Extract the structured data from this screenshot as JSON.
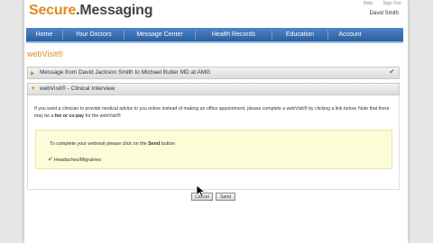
{
  "brand": {
    "part1": "Secure",
    "part2": ".Messaging"
  },
  "top_links": {
    "help": "Help",
    "sign_out": "Sign Out"
  },
  "user_name": "David Smith",
  "nav": [
    "Home",
    "Your Doctors",
    "Message Center",
    "Health Records",
    "Education",
    "Account"
  ],
  "section_title": "webVisit®",
  "message_bar": "Message from David Jackson Smith to Michael Butler MD at AMG",
  "interview_bar": "webVisit® - Clinical Interview",
  "intro": {
    "pre": "If you want a clinician to provide medical advice to you online instead of making an office appointment, please complete a webVisit® by clicking a link below. Note that there may be a ",
    "bold": "fee or co-pay",
    "post": " for the webVisit®"
  },
  "instruction": {
    "pre": "To complete your webvisit please click on the ",
    "bold": "Send",
    "post": " button"
  },
  "option": "Headaches/Migraines",
  "buttons": {
    "cancel": "Cancel",
    "send": "Send"
  },
  "colors": {
    "accent": "#e08a1e",
    "nav": "#2a5e9f",
    "check": "#3a9a3a",
    "callout": "#fcfcd8"
  }
}
